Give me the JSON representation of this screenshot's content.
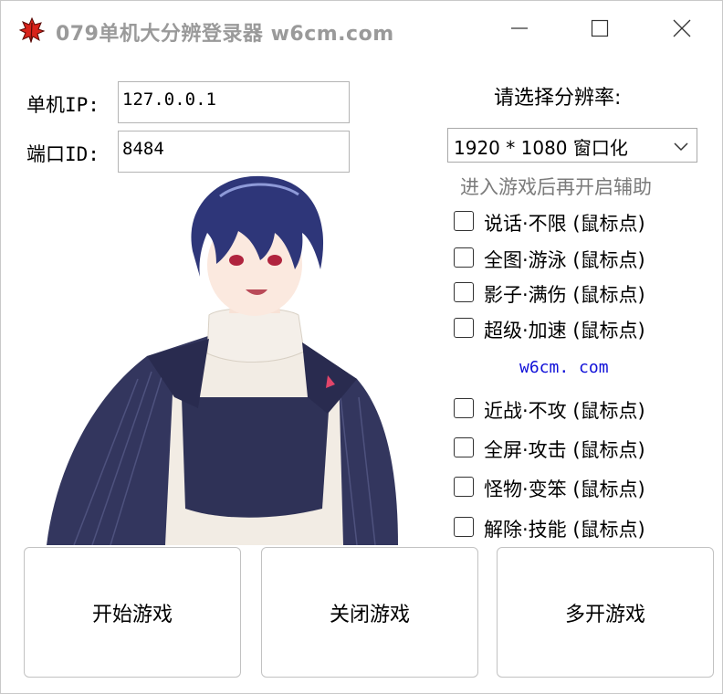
{
  "window": {
    "title": "079单机大分辨登录器  w6cm.com"
  },
  "fields": {
    "ip_label": "单机IP:",
    "ip_value": "127.0.0.1",
    "port_label": "端口ID:",
    "port_value": "8484"
  },
  "resolution": {
    "title": "请选择分辨率:",
    "selected": "1920 * 1080 窗口化",
    "hint": "进入游戏后再开启辅助"
  },
  "options_top": [
    {
      "label": "说话·不限 (鼠标点)",
      "checked": false
    },
    {
      "label": "全图·游泳 (鼠标点)",
      "checked": false
    },
    {
      "label": "影子·满伤 (鼠标点)",
      "checked": false
    },
    {
      "label": "超级·加速 (鼠标点)",
      "checked": false
    }
  ],
  "site_link": "w6cm. com",
  "options_bottom": [
    {
      "label": "近战·不攻 (鼠标点)",
      "checked": false
    },
    {
      "label": "全屏·攻击 (鼠标点)",
      "checked": false
    },
    {
      "label": "怪物·变笨 (鼠标点)",
      "checked": false
    },
    {
      "label": "解除·技能 (鼠标点)",
      "checked": false
    }
  ],
  "buttons": {
    "start": "开始游戏",
    "close": "关闭游戏",
    "multi": "多开游戏"
  },
  "colors": {
    "title_text": "#9a9a9a",
    "link": "#1010d8",
    "hint": "#7b7b7b",
    "icon_red": "#d8231b"
  },
  "icons": [
    "maple-leaf-icon",
    "minimize-icon",
    "maximize-icon",
    "close-icon",
    "chevron-down-icon"
  ]
}
